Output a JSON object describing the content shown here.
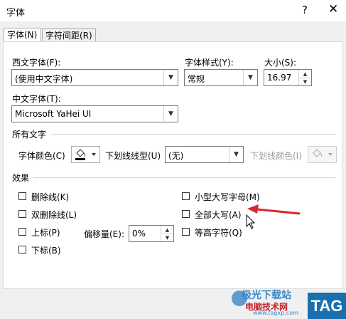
{
  "dialog": {
    "title": "字体",
    "help_glyph": "?",
    "close_glyph": "✕"
  },
  "tabs": [
    {
      "label": "字体(N)"
    },
    {
      "label": "字符间距(R)"
    }
  ],
  "western_font": {
    "label": "西文字体(F):",
    "value": "(使用中文字体)"
  },
  "font_style": {
    "label": "字体样式(Y):",
    "value": "常规"
  },
  "size": {
    "label": "大小(S):",
    "value": "16.97"
  },
  "chinese_font": {
    "label": "中文字体(T):",
    "value": "Microsoft YaHei UI"
  },
  "all_text": {
    "heading": "所有文字",
    "font_color_label": "字体颜色(C)",
    "underline_type_label": "下划线线型(U)",
    "underline_type_value": "(无)",
    "underline_color_label": "下划线颜色(I)"
  },
  "effects": {
    "heading": "效果",
    "left": [
      {
        "label": "删除线(K)"
      },
      {
        "label": "双删除线(L)"
      },
      {
        "label": "上标(P)"
      },
      {
        "label": "下标(B)"
      }
    ],
    "offset_label": "偏移量(E):",
    "offset_value": "0%",
    "right": [
      {
        "label": "小型大写字母(M)"
      },
      {
        "label": "全部大写(A)"
      },
      {
        "label": "等高字符(Q)"
      }
    ]
  },
  "watermark": {
    "brand_line": "极光下载站",
    "site_line": "电脑技术网",
    "url_line": "www.tagxp.com",
    "badge": "TAG"
  },
  "colors": {
    "annotation_arrow": "#d9262c",
    "badge_bg": "#1a6fb0"
  }
}
